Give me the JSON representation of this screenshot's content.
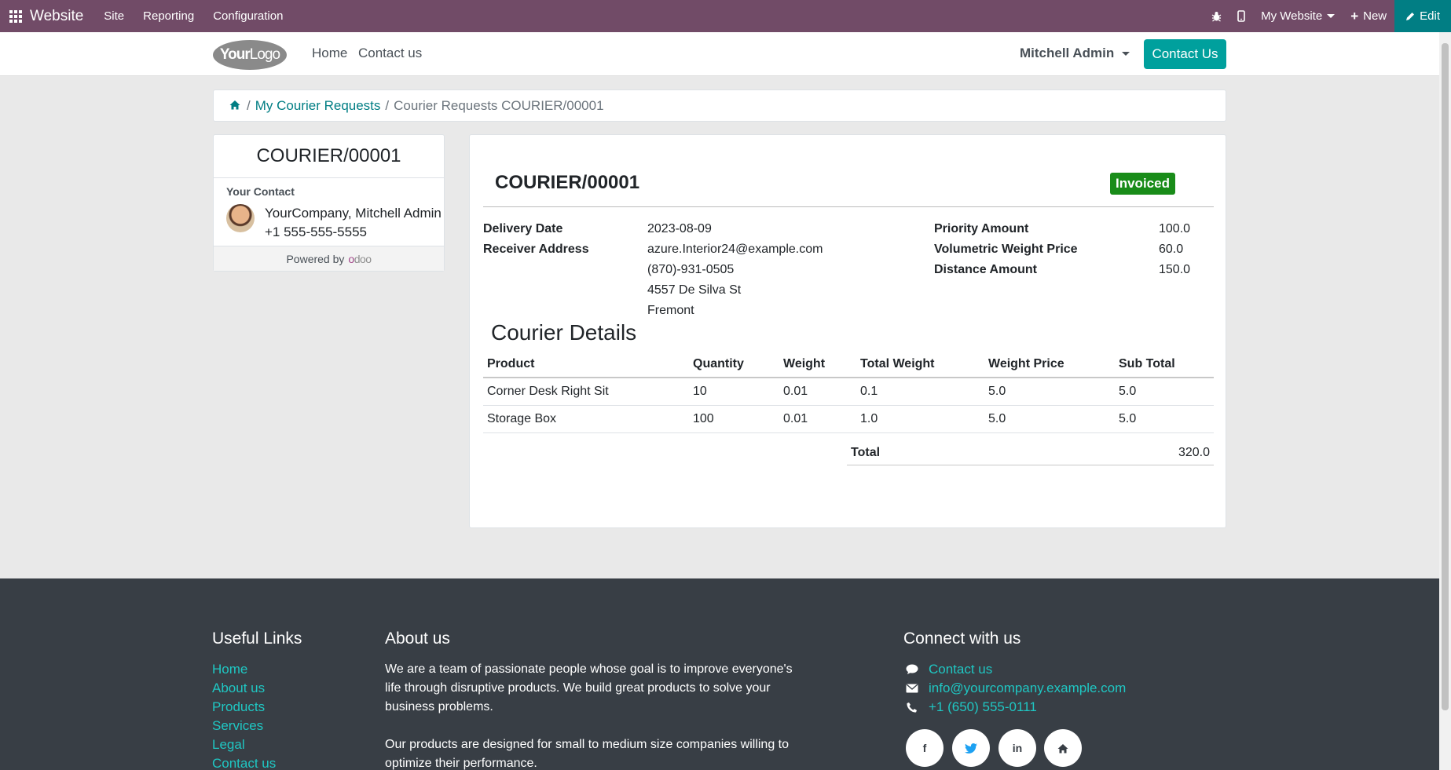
{
  "topbar": {
    "brand": "Website",
    "menu": [
      "Site",
      "Reporting",
      "Configuration"
    ],
    "website_selector": "My Website",
    "new_label": "New",
    "edit_label": "Edit"
  },
  "header": {
    "logo_text_bold": "Your",
    "logo_text": "Logo",
    "nav": [
      "Home",
      "Contact us"
    ],
    "user": "Mitchell Admin",
    "contact_button": "Contact Us"
  },
  "breadcrumb": {
    "link": "My Courier Requests",
    "current": "Courier Requests COURIER/00001"
  },
  "sidecard": {
    "title": "COURIER/00001",
    "your_contact_label": "Your Contact",
    "contact_name": "YourCompany, Mitchell Admin",
    "contact_phone": "+1 555-555-5555",
    "powered_by": "Powered by"
  },
  "courier": {
    "title": "COURIER/00001",
    "status": "Invoiced",
    "delivery_date_label": "Delivery Date",
    "delivery_date": "2023-08-09",
    "receiver_address_label": "Receiver Address",
    "receiver_email": "azure.Interior24@example.com",
    "receiver_phone": "(870)-931-0505",
    "receiver_street": "4557 De Silva St",
    "receiver_city": "Fremont",
    "priority_amount_label": "Priority Amount",
    "priority_amount": "100.0",
    "volumetric_weight_price_label": "Volumetric Weight Price",
    "volumetric_weight_price": "60.0",
    "distance_amount_label": "Distance Amount",
    "distance_amount": "150.0",
    "details_title": "Courier Details",
    "columns": [
      "Product",
      "Quantity",
      "Weight",
      "Total Weight",
      "Weight Price",
      "Sub Total"
    ],
    "rows": [
      [
        "Corner Desk Right Sit",
        "10",
        "0.01",
        "0.1",
        "5.0",
        "5.0"
      ],
      [
        "Storage Box",
        "100",
        "0.01",
        "1.0",
        "5.0",
        "5.0"
      ]
    ],
    "total_label": "Total",
    "total": "320.0"
  },
  "footer": {
    "useful_links_title": "Useful Links",
    "useful_links": [
      "Home",
      "About us",
      "Products",
      "Services",
      "Legal",
      "Contact us"
    ],
    "about_title": "About us",
    "about_p1": "We are a team of passionate people whose goal is to improve everyone's life through disruptive products. We build great products to solve your business problems.",
    "about_p2": "Our products are designed for small to medium size companies willing to optimize their performance.",
    "connect_title": "Connect with us",
    "contact_link": "Contact us",
    "email": "info@yourcompany.example.com",
    "phone": "+1 (650) 555-0111",
    "social": [
      "facebook-icon",
      "twitter-icon",
      "linkedin-icon",
      "home-icon"
    ]
  }
}
